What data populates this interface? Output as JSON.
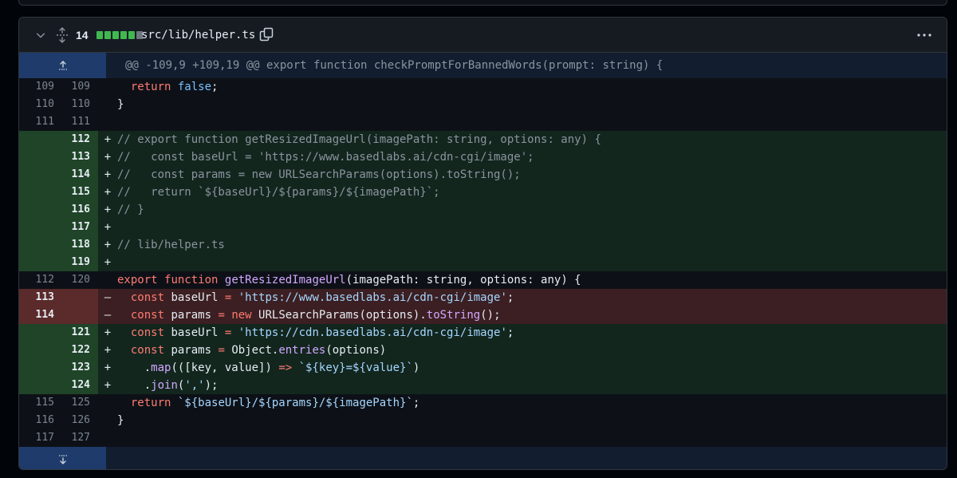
{
  "file": {
    "changes_count": "14",
    "diffstat": [
      "added",
      "added",
      "added",
      "added",
      "added",
      "neutral"
    ],
    "path": "src/lib/helper.ts",
    "icons": {
      "collapse": "chevron-down-icon",
      "expand_all": "unfold-icon",
      "copy": "copy-icon",
      "menu": "kebab-horizontal-icon",
      "expand_up": "expand-up-icon",
      "expand_down": "expand-down-icon"
    }
  },
  "hunk_header": "@@ -109,9 +109,19 @@ export function checkPromptForBannedWords(prompt: string) {",
  "colors": {
    "added_bg": "#12261e",
    "added_gutter": "#1f4428",
    "deleted_bg": "#3c1f22",
    "deleted_gutter": "#5b2a2b",
    "hunk_bg": "#121d2f",
    "expander_bg": "#1f3b6b"
  },
  "lines": [
    {
      "type": "ctx",
      "old": "109",
      "new": "109",
      "segs": [
        [
          "",
          "  "
        ],
        [
          "kw",
          "return"
        ],
        [
          "",
          " "
        ],
        [
          "con",
          "false"
        ],
        [
          "",
          ";"
        ]
      ]
    },
    {
      "type": "ctx",
      "old": "110",
      "new": "110",
      "segs": [
        [
          "",
          "}"
        ]
      ]
    },
    {
      "type": "ctx",
      "old": "111",
      "new": "111",
      "segs": [
        [
          "",
          ""
        ]
      ]
    },
    {
      "type": "add",
      "old": "",
      "new": "112",
      "segs": [
        [
          "cm",
          "// export function getResizedImageUrl(imagePath: string, options: any) {"
        ]
      ]
    },
    {
      "type": "add",
      "old": "",
      "new": "113",
      "segs": [
        [
          "cm",
          "//   const baseUrl = 'https://www.basedlabs.ai/cdn-cgi/image';"
        ]
      ]
    },
    {
      "type": "add",
      "old": "",
      "new": "114",
      "segs": [
        [
          "cm",
          "//   const params = new URLSearchParams(options).toString();"
        ]
      ]
    },
    {
      "type": "add",
      "old": "",
      "new": "115",
      "segs": [
        [
          "cm",
          "//   return `${baseUrl}/${params}/${imagePath}`;"
        ]
      ]
    },
    {
      "type": "add",
      "old": "",
      "new": "116",
      "segs": [
        [
          "cm",
          "// }"
        ]
      ]
    },
    {
      "type": "add",
      "old": "",
      "new": "117",
      "segs": [
        [
          "",
          ""
        ]
      ]
    },
    {
      "type": "add",
      "old": "",
      "new": "118",
      "segs": [
        [
          "cm",
          "// lib/helper.ts"
        ]
      ]
    },
    {
      "type": "add",
      "old": "",
      "new": "119",
      "segs": [
        [
          "",
          ""
        ]
      ]
    },
    {
      "type": "ctx",
      "old": "112",
      "new": "120",
      "segs": [
        [
          "kw",
          "export"
        ],
        [
          "",
          " "
        ],
        [
          "kw",
          "function"
        ],
        [
          "",
          " "
        ],
        [
          "fn",
          "getResizedImageUrl"
        ],
        [
          "",
          "(imagePath: string, options: any) {"
        ]
      ]
    },
    {
      "type": "del",
      "old": "113",
      "new": "",
      "segs": [
        [
          "",
          "  "
        ],
        [
          "kw",
          "const"
        ],
        [
          "",
          " baseUrl "
        ],
        [
          "kw",
          "="
        ],
        [
          "",
          " "
        ],
        [
          "str",
          "'https://www.basedlabs.ai/cdn-cgi/image'"
        ],
        [
          "",
          ";"
        ]
      ]
    },
    {
      "type": "del",
      "old": "114",
      "new": "",
      "segs": [
        [
          "",
          "  "
        ],
        [
          "kw",
          "const"
        ],
        [
          "",
          " params "
        ],
        [
          "kw",
          "="
        ],
        [
          "",
          " "
        ],
        [
          "kw",
          "new"
        ],
        [
          "",
          " URLSearchParams(options)."
        ],
        [
          "fn",
          "toString"
        ],
        [
          "",
          "();"
        ]
      ]
    },
    {
      "type": "add",
      "old": "",
      "new": "121",
      "segs": [
        [
          "",
          "  "
        ],
        [
          "kw",
          "const"
        ],
        [
          "",
          " baseUrl "
        ],
        [
          "kw",
          "="
        ],
        [
          "",
          " "
        ],
        [
          "str",
          "'https://cdn.basedlabs.ai/cdn-cgi/image'"
        ],
        [
          "",
          ";"
        ]
      ]
    },
    {
      "type": "add",
      "old": "",
      "new": "122",
      "segs": [
        [
          "",
          "  "
        ],
        [
          "kw",
          "const"
        ],
        [
          "",
          " params "
        ],
        [
          "kw",
          "="
        ],
        [
          "",
          " Object."
        ],
        [
          "fn",
          "entries"
        ],
        [
          "",
          "(options)"
        ]
      ]
    },
    {
      "type": "add",
      "old": "",
      "new": "123",
      "segs": [
        [
          "",
          "    ."
        ],
        [
          "fn",
          "map"
        ],
        [
          "",
          "(([key, value]) "
        ],
        [
          "kw",
          "=>"
        ],
        [
          "",
          " "
        ],
        [
          "str",
          "`${key}=${value}`"
        ],
        [
          "",
          ")"
        ]
      ]
    },
    {
      "type": "add",
      "old": "",
      "new": "124",
      "segs": [
        [
          "",
          "    ."
        ],
        [
          "fn",
          "join"
        ],
        [
          "",
          "("
        ],
        [
          "str",
          "','"
        ],
        [
          "",
          ");"
        ]
      ]
    },
    {
      "type": "ctx",
      "old": "115",
      "new": "125",
      "segs": [
        [
          "",
          "  "
        ],
        [
          "kw",
          "return"
        ],
        [
          "",
          " "
        ],
        [
          "str",
          "`${baseUrl}/${params}/${imagePath}`"
        ],
        [
          "",
          ";"
        ]
      ]
    },
    {
      "type": "ctx",
      "old": "116",
      "new": "126",
      "segs": [
        [
          "",
          "}"
        ]
      ]
    },
    {
      "type": "ctx",
      "old": "117",
      "new": "127",
      "segs": [
        [
          "",
          ""
        ]
      ]
    }
  ]
}
